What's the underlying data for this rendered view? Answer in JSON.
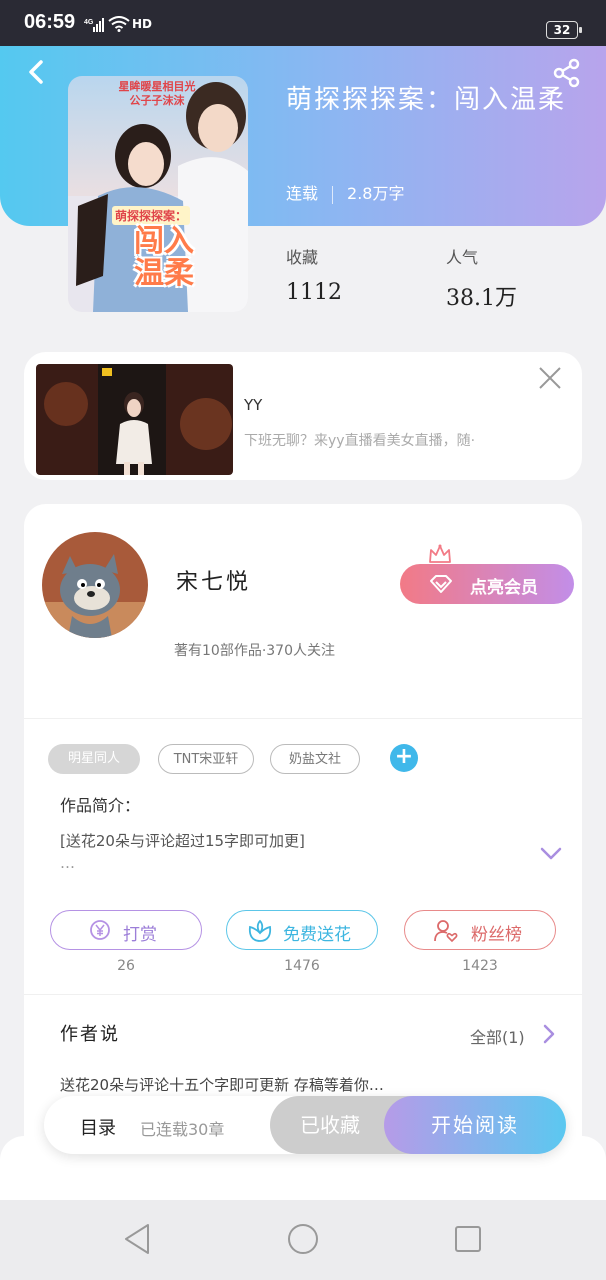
{
  "status_bar": {
    "time": "06:59",
    "network": "4G",
    "hd": "HD",
    "battery": "32"
  },
  "header": {
    "back_icon": "chevron-left-icon",
    "share_icon": "share-icon"
  },
  "book": {
    "title": "萌探探探案：闯入温柔",
    "status": "连载",
    "word_count": "2.8万字",
    "favorites_label": "收藏",
    "favorites_value": "1112",
    "popularity_label": "人气",
    "popularity_value": "38.1万",
    "cover_texts": {
      "top": "星眸暖星相目光\n公子子沫沫",
      "badge": "萌探探探案：",
      "main": "闯入\n温柔"
    }
  },
  "ad": {
    "name": "YY",
    "description": "下班无聊？来yy直播看美女直播，随·",
    "close_icon": "close-icon"
  },
  "author": {
    "name": "宋七悦",
    "stats": "著有10部作品·370人关注",
    "vip_button": "点亮会员"
  },
  "tags": [
    "明星同人",
    "TNT宋亚轩",
    "奶盐文社"
  ],
  "intro": {
    "label": "作品简介：",
    "text": "[送花20朵与评论超过15字即可加更]",
    "more": "…"
  },
  "actions": {
    "reward_label": "打赏",
    "reward_count": "26",
    "flower_label": "免费送花",
    "flower_count": "1476",
    "fans_label": "粉丝榜",
    "fans_count": "1423"
  },
  "author_says": {
    "label": "作者说",
    "all": "全部(1)",
    "text": "送花20朵与评论十五个字即可更新 存稿等着你…"
  },
  "bottom_bar": {
    "toc_label": "目录",
    "toc_sub": "已连载30章",
    "collected": "已收藏",
    "start_reading": "开始阅读"
  },
  "colors": {
    "header_start": "#54c9f0",
    "header_end": "#b8a4ec",
    "accent_blue": "#40b8ea",
    "accent_purple": "#b592e4",
    "accent_red": "#e88a8a"
  }
}
